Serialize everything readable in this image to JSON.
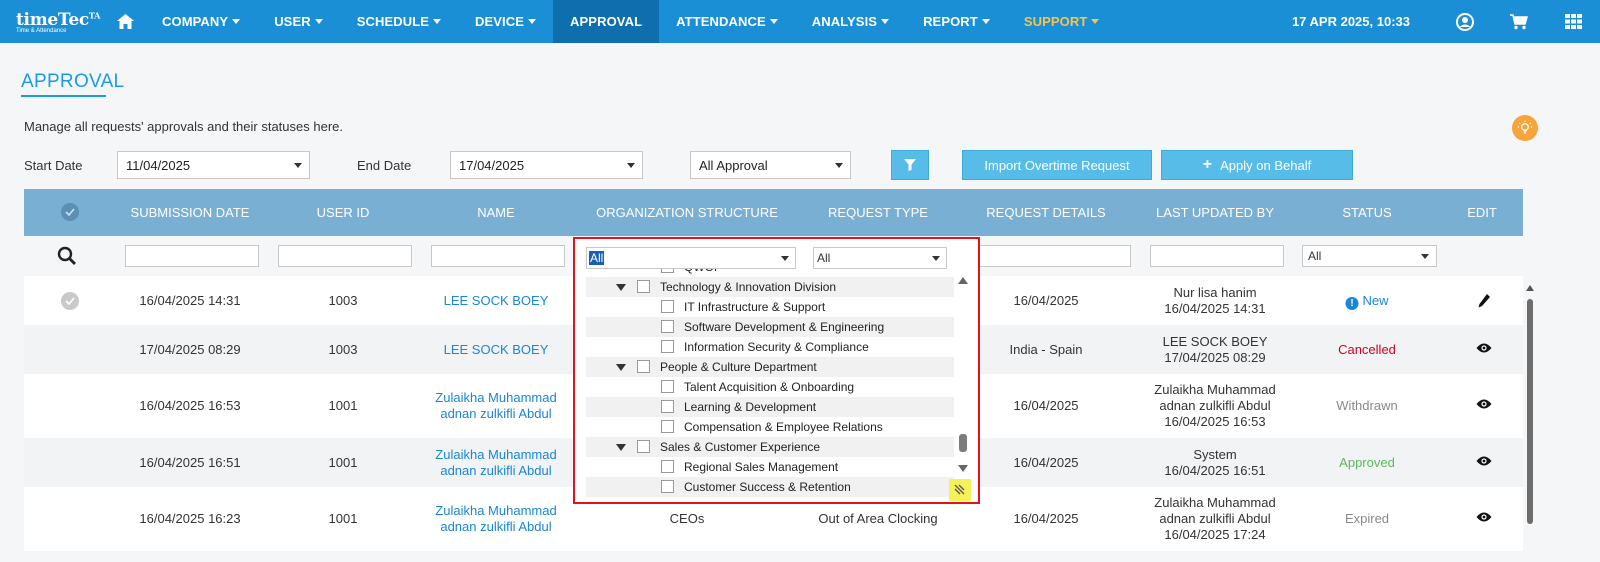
{
  "nav": {
    "brand": "timeTec",
    "brand_sup": "TA",
    "tagline": "Time & Attendance",
    "items": [
      {
        "label": "COMPANY",
        "caret": true
      },
      {
        "label": "USER",
        "caret": true
      },
      {
        "label": "SCHEDULE",
        "caret": true
      },
      {
        "label": "DEVICE",
        "caret": true
      },
      {
        "label": "APPROVAL",
        "caret": false,
        "active": true
      },
      {
        "label": "ATTENDANCE",
        "caret": true
      },
      {
        "label": "ANALYSIS",
        "caret": true
      },
      {
        "label": "REPORT",
        "caret": true
      },
      {
        "label": "SUPPORT",
        "caret": true,
        "highlight": "#f9c34b"
      }
    ],
    "datetime": "17 APR 2025, 10:33",
    "icons": [
      "home-icon",
      "user-circle-icon",
      "cart-icon",
      "grid-icon"
    ]
  },
  "page": {
    "title": "APPROVAL",
    "description": "Manage all requests' approvals and their statuses here."
  },
  "filters": {
    "start_label": "Start Date",
    "start_value": "11/04/2025",
    "end_label": "End Date",
    "end_value": "17/04/2025",
    "approval_value": "All Approval",
    "import_label": "Import Overtime Request",
    "behalf_label": "Apply on Behalf"
  },
  "table": {
    "headers": [
      "SUBMISSION DATE",
      "USER ID",
      "NAME",
      "ORGANIZATION STRUCTURE",
      "REQUEST TYPE",
      "REQUEST DETAILS",
      "LAST UPDATED BY",
      "STATUS",
      "EDIT"
    ],
    "filter_org_value": "All",
    "filter_type_value": "All",
    "filter_status_value": "All",
    "rows": [
      {
        "date": "16/04/2025 14:31",
        "user_id": "1003",
        "name": [
          "LEE SOCK BOEY"
        ],
        "org": "",
        "type": "",
        "details": "16/04/2025",
        "updated": [
          "Nur lisa hanim",
          "16/04/2025 14:31"
        ],
        "status": "New",
        "status_class": "st-new",
        "action": "pencil-icon",
        "checkbox": true
      },
      {
        "date": "17/04/2025 08:29",
        "user_id": "1003",
        "name": [
          "LEE SOCK BOEY"
        ],
        "org": "",
        "type": "",
        "details": "India - Spain",
        "updated": [
          "LEE SOCK BOEY",
          "17/04/2025 08:29"
        ],
        "status": "Cancelled",
        "status_class": "st-cancel",
        "action": "eye-icon",
        "checkbox": false
      },
      {
        "date": "16/04/2025 16:53",
        "user_id": "1001",
        "name": [
          "Zulaikha Muhammad",
          "adnan zulkifli Abdul"
        ],
        "org": "",
        "type": "",
        "details": "16/04/2025",
        "updated": [
          "Zulaikha Muhammad",
          "adnan zulkifli Abdul",
          "16/04/2025 16:53"
        ],
        "status": "Withdrawn",
        "status_class": "st-withdrawn",
        "action": "eye-icon",
        "checkbox": false
      },
      {
        "date": "16/04/2025 16:51",
        "user_id": "1001",
        "name": [
          "Zulaikha Muhammad",
          "adnan zulkifli Abdul"
        ],
        "org": "",
        "type": "",
        "details": "16/04/2025",
        "updated": [
          "System",
          "16/04/2025 16:51"
        ],
        "status": "Approved",
        "status_class": "st-approved",
        "action": "eye-icon",
        "checkbox": false
      },
      {
        "date": "16/04/2025 16:23",
        "user_id": "1001",
        "name": [
          "Zulaikha Muhammad",
          "adnan zulkifli Abdul"
        ],
        "org": "CEOs",
        "type": "Out of Area Clocking",
        "details": "16/04/2025",
        "updated": [
          "Zulaikha Muhammad",
          "adnan zulkifli Abdul",
          "16/04/2025 17:24"
        ],
        "status": "Expired",
        "status_class": "st-expired",
        "action": "eye-icon",
        "checkbox": false
      }
    ]
  },
  "org_dropdown": {
    "selected": "All",
    "type_value": "All",
    "tree": [
      {
        "label": "QWOP",
        "level": 2,
        "toggle": false
      },
      {
        "label": "Technology & Innovation Division",
        "level": 1,
        "toggle": true
      },
      {
        "label": "IT Infrastructure & Support",
        "level": 2,
        "toggle": false
      },
      {
        "label": "Software Development & Engineering",
        "level": 2,
        "toggle": false
      },
      {
        "label": "Information Security & Compliance",
        "level": 2,
        "toggle": false
      },
      {
        "label": "People & Culture Department",
        "level": 1,
        "toggle": true
      },
      {
        "label": "Talent Acquisition & Onboarding",
        "level": 2,
        "toggle": false
      },
      {
        "label": "Learning & Development",
        "level": 2,
        "toggle": false
      },
      {
        "label": "Compensation & Employee Relations",
        "level": 2,
        "toggle": false
      },
      {
        "label": "Sales & Customer Experience",
        "level": 1,
        "toggle": true
      },
      {
        "label": "Regional Sales Management",
        "level": 2,
        "toggle": false
      },
      {
        "label": "Customer Success & Retention",
        "level": 2,
        "toggle": false
      }
    ]
  }
}
